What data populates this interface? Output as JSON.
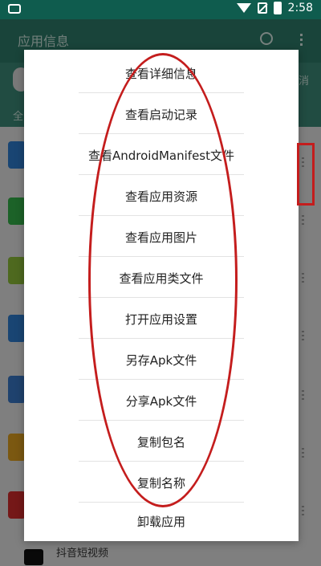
{
  "status_bar": {
    "time": "2:58"
  },
  "app_bar": {
    "title": "应用信息"
  },
  "filter_bar": {
    "cancel": "消",
    "all": "全"
  },
  "background_list": {
    "bottom_item": "抖音短视频"
  },
  "menu": {
    "items": [
      "查看详细信息",
      "查看启动记录",
      "查看AndroidManifest文件",
      "查看应用资源",
      "查看应用图片",
      "查看应用类文件",
      "打开应用设置",
      "另存Apk文件",
      "分享Apk文件",
      "复制包名",
      "复制名称",
      "卸载应用"
    ]
  },
  "colors": {
    "status_bar": "#0f5c4e",
    "app_bar": "#2e7d6b",
    "annotation": "#c41d1d"
  }
}
